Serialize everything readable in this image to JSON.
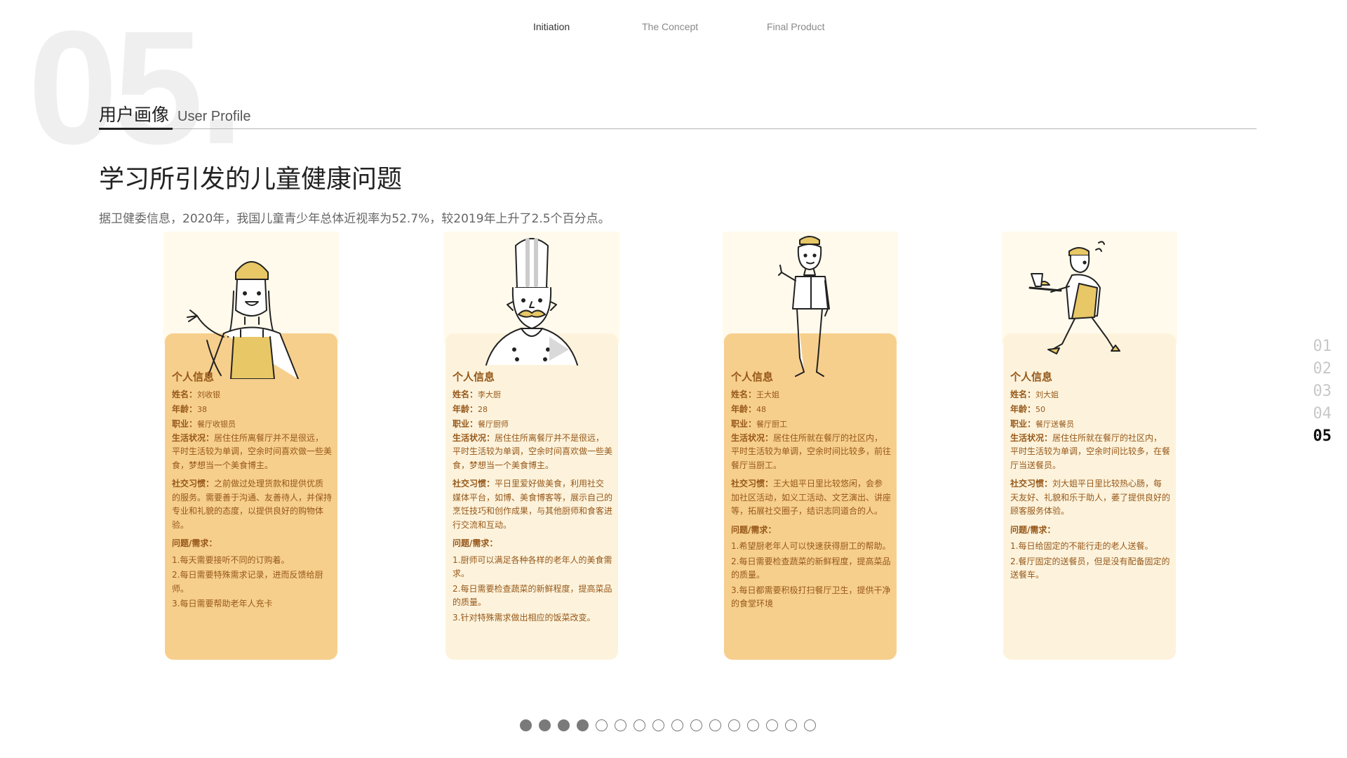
{
  "slide": {
    "number": "05.",
    "section_cn": "用户画像",
    "section_en": "User Profile",
    "headline": "学习所引发的儿童健康问题",
    "subline": "据卫健委信息，2020年，我国儿童青少年总体近视率为52.7%，较2019年上升了2.5个百分点。"
  },
  "top_nav": [
    {
      "label": "Initiation",
      "active": true
    },
    {
      "label": "The Concept",
      "active": false
    },
    {
      "label": "Final Product",
      "active": false
    }
  ],
  "colors": {
    "card_deep": "#f7cf8d",
    "card_light": "#fdf3dc",
    "text_brown": "#96581a",
    "accent_yellow": "#e8c766"
  },
  "cards": [
    {
      "illustration": "cashier-illustration",
      "heading": "个人信息",
      "name_label": "姓名：",
      "name": "刘收银",
      "age_label": "年龄：",
      "age": "38",
      "job_label": "职业：",
      "job": "餐厅收银员",
      "life_label": "生活状况：",
      "life": "居住住所离餐厅并不是很远，平时生活较为单调，空余时间喜欢做一些美食，梦想当一个美食博主。",
      "social_label": "社交习惯：",
      "social": "之前做过处理货款和提供优质的服务。需要善于沟通、友善待人，并保持专业和礼貌的态度，以提供良好的购物体验。",
      "needs_label": "问题/需求：",
      "needs": [
        "1.每天需要接听不同的订购着。",
        "2.每日需要特殊需求记录，进而反馈给厨师。",
        "3.每日需要帮助老年人充卡"
      ]
    },
    {
      "illustration": "chef-illustration",
      "heading": "个人信息",
      "name_label": "姓名：",
      "name": "李大厨",
      "age_label": "年龄：",
      "age": "28",
      "job_label": "职业：",
      "job": "餐厅厨师",
      "life_label": "生活状况：",
      "life": "居住住所离餐厅并不是很远，平时生活较为单调，空余时间喜欢做一些美食，梦想当一个美食博主。",
      "social_label": "社交习惯：",
      "social": "平日里爱好做美食，利用社交媒体平台，如博、美食博客等，展示自己的烹饪技巧和创作成果，与其他厨师和食客进行交流和互动。",
      "needs_label": "问题/需求：",
      "needs": [
        "1.厨师可以满足各种各样的老年人的美食需求。",
        "2.每日需要检查蔬菜的新鲜程度，提高菜品的质量。",
        "3.针对特殊需求做出相应的饭菜改变。"
      ]
    },
    {
      "illustration": "cook-woman-illustration",
      "heading": "个人信息",
      "name_label": "姓名：",
      "name": "王大姐",
      "age_label": "年龄：",
      "age": "48",
      "job_label": "职业：",
      "job": "餐厅厨工",
      "life_label": "生活状况：",
      "life": "居住住所就在餐厅的社区内，平时生活较为单调，空余时间比较多，前往餐厅当厨工。",
      "social_label": "社交习惯：",
      "social": "王大姐平日里比较悠闲，会参加社区活动，如义工活动、文艺演出、讲座等，拓展社交圈子，结识志同道合的人。",
      "needs_label": "问题/需求：",
      "needs": [
        "1.希望厨老年人可以快速获得厨工的帮助。",
        "2.每日需要检查蔬菜的新鲜程度，提高菜品的质量。",
        "3.每日都需要积极打扫餐厅卫生，提供干净的食堂环境"
      ]
    },
    {
      "illustration": "delivery-illustration",
      "heading": "个人信息",
      "name_label": "姓名：",
      "name": "刘大姐",
      "age_label": "年龄：",
      "age": "50",
      "job_label": "职业：",
      "job": "餐厅送餐员",
      "life_label": "生活状况：",
      "life": "居住住所就在餐厅的社区内，平时生活较为单调，空余时间比较多，在餐厅当送餐员。",
      "social_label": "社交习惯：",
      "social": "刘大姐平日里比较热心肠，每天友好、礼貌和乐于助人，萎了提供良好的顾客服务体验。",
      "needs_label": "问题/需求：",
      "needs": [
        "1.每日给固定的不能行走的老人送餐。",
        "2.餐厅固定的送餐员，但是没有配备固定的送餐车。"
      ]
    }
  ],
  "side_nav": [
    "01",
    "02",
    "03",
    "04",
    "05"
  ],
  "side_nav_active": "05",
  "pagination": {
    "total": 16,
    "filled": 4
  }
}
